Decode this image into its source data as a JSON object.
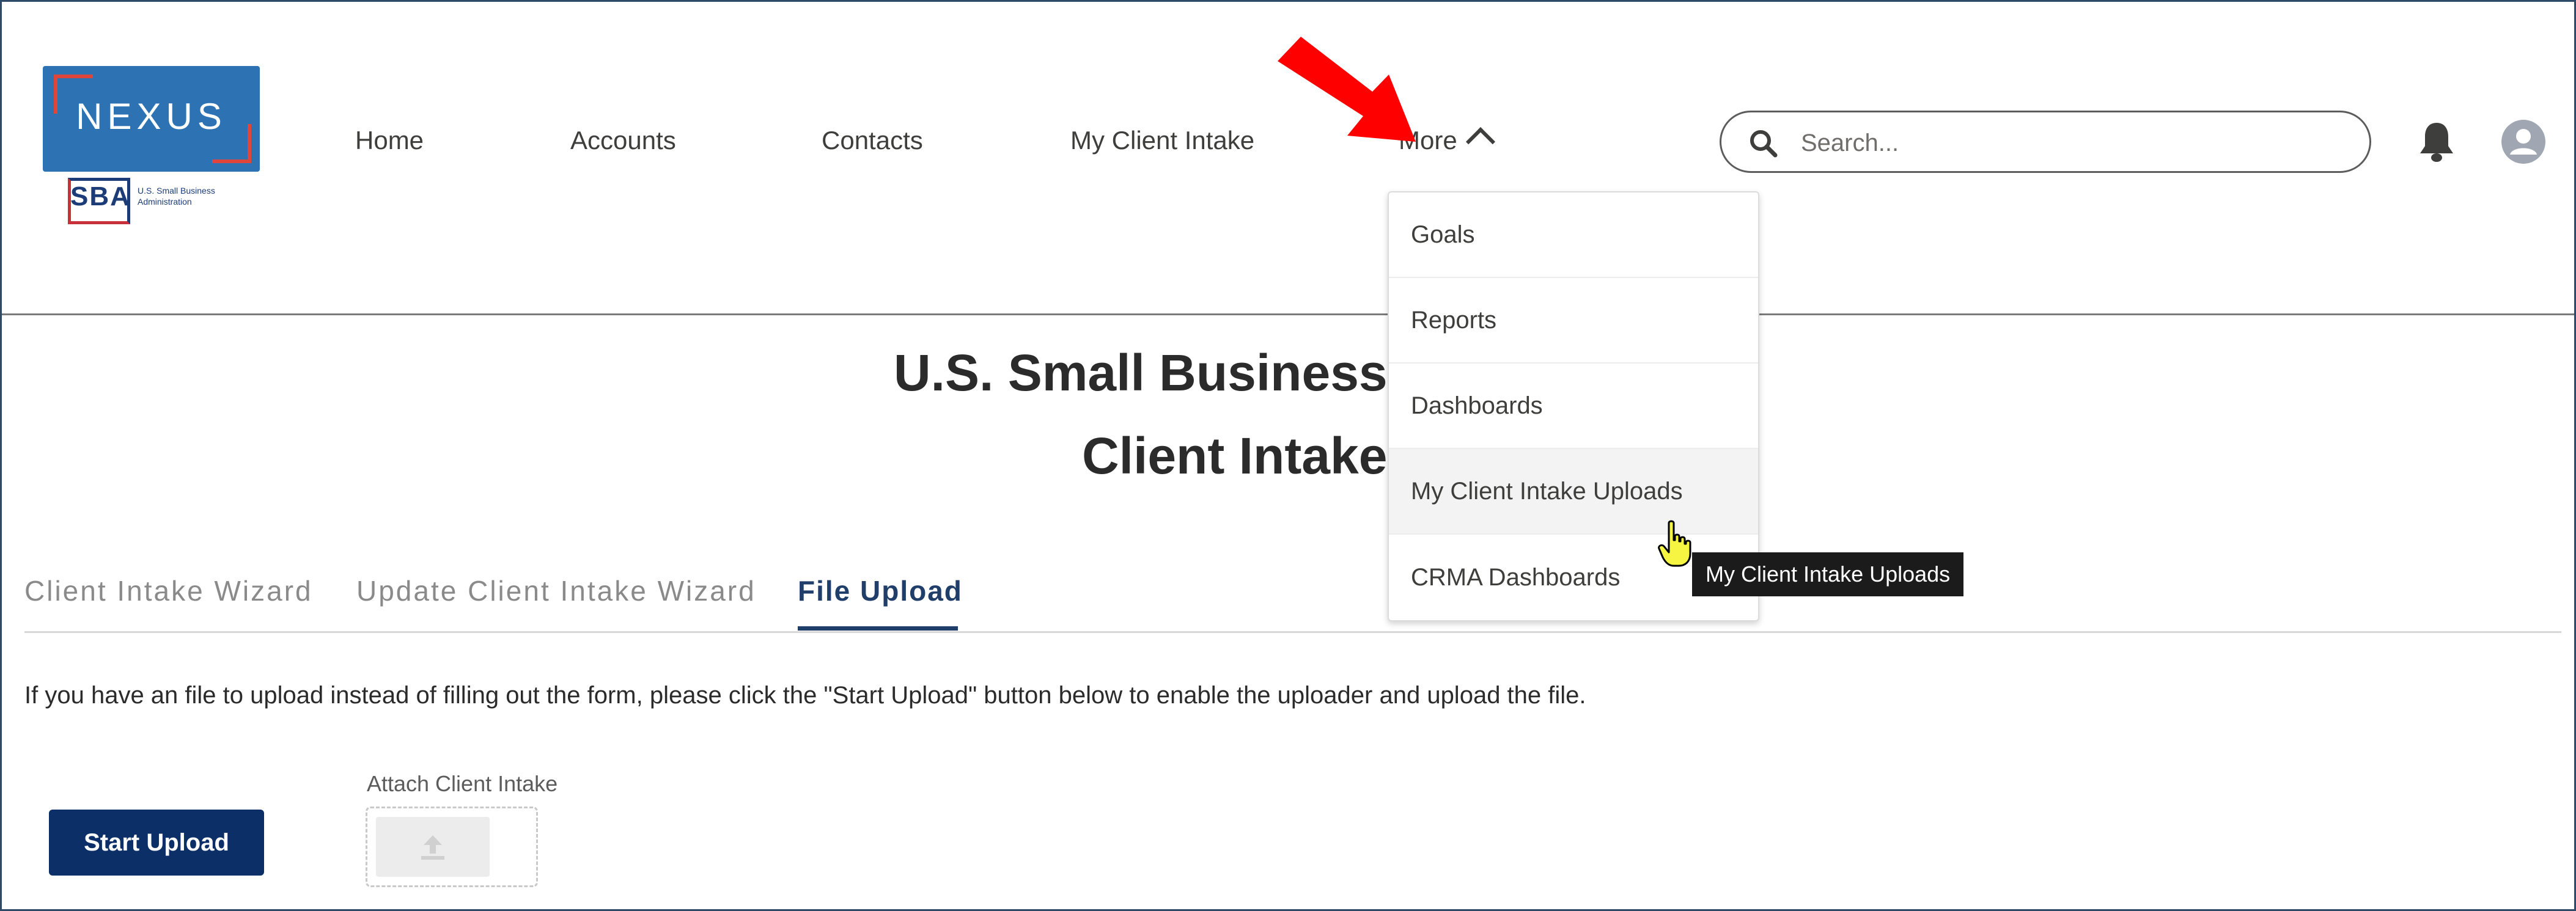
{
  "brand": {
    "logo_text": "NEXUS",
    "sba_text": "SBA",
    "sba_subtext": "U.S. Small Business Administration"
  },
  "nav": {
    "items": [
      "Home",
      "Accounts",
      "Contacts",
      "My Client Intake"
    ],
    "more_label": "More"
  },
  "search": {
    "placeholder": "Search..."
  },
  "page": {
    "title_line1": "U.S. Small Business Ac",
    "title_line2": "Client Intake F"
  },
  "tabs": [
    {
      "label": "Client Intake Wizard",
      "active": false
    },
    {
      "label": "Update Client Intake Wizard",
      "active": false
    },
    {
      "label": "File Upload",
      "active": true
    }
  ],
  "instruction": "If you have an file to upload instead of filling out the form, please click the \"Start Upload\" button below to enable the uploader and upload the file.",
  "start_upload_label": "Start Upload",
  "attach_label": "Attach Client Intake",
  "dropdown": {
    "items": [
      "Goals",
      "Reports",
      "Dashboards",
      "My Client Intake Uploads",
      "CRMA Dashboards"
    ],
    "hovered": "My Client Intake Uploads"
  },
  "tooltip": "My Client Intake Uploads",
  "colors": {
    "brand_blue": "#2d73b4",
    "primary_button": "#0b2f66",
    "active_tab": "#1f3f6a",
    "annotation_arrow": "#ff0000",
    "tooltip_bg": "#1b1b1b"
  },
  "icons": [
    "search-icon",
    "bell-icon",
    "avatar-icon",
    "chevron-up-icon",
    "upload-icon",
    "hand-cursor-icon",
    "red-arrow-annotation"
  ]
}
